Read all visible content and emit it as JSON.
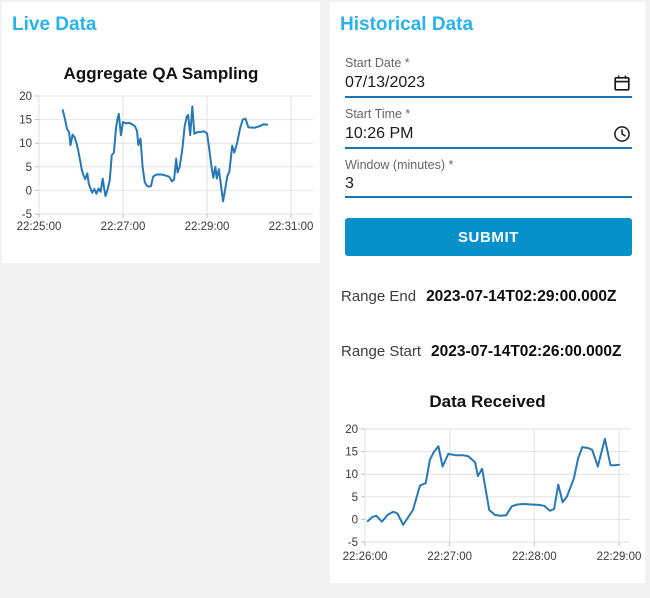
{
  "page": {
    "background_color": "#f2f2f2",
    "accent_color": "#29b2ec"
  },
  "live": {
    "title": "Live Data"
  },
  "historical": {
    "title": "Historical Data",
    "fields": {
      "start_date": {
        "label": "Start Date *",
        "value": "07/13/2023",
        "icon": "calendar-icon"
      },
      "start_time": {
        "label": "Start Time *",
        "value": "10:26 PM",
        "icon": "clock-icon"
      },
      "window": {
        "label": "Window (minutes) *",
        "value": "3"
      }
    },
    "submit_label": "SUBMIT",
    "submit_color": "#0791ca",
    "underline_color": "#1b74b8",
    "range_end": {
      "label": "Range End",
      "value": "2023-07-14T02:29:00.000Z"
    },
    "range_start": {
      "label": "Range Start",
      "value": "2023-07-14T02:26:00.000Z"
    }
  },
  "chart_data": [
    {
      "id": "live-chart",
      "type": "line",
      "title": "Aggregate QA Sampling",
      "xlabel": "",
      "ylabel": "",
      "line_color": "#2878b5",
      "grid": true,
      "x_axis": {
        "origin_time": "22:25:00",
        "unit": "seconds after 22:25:00",
        "ticks": [
          {
            "s": 0,
            "label": "22:25:00"
          },
          {
            "s": 120,
            "label": "22:27:00"
          },
          {
            "s": 240,
            "label": "22:29:00"
          },
          {
            "s": 360,
            "label": "22:31:00"
          }
        ]
      },
      "y_axis": {
        "min": -5,
        "max": 20,
        "ticks": [
          -5,
          0,
          5,
          10,
          15,
          20
        ]
      },
      "points": [
        [
          34,
          17.0
        ],
        [
          37,
          15.2
        ],
        [
          40,
          13.0
        ],
        [
          43,
          12.3
        ],
        [
          45,
          9.6
        ],
        [
          48,
          11.8
        ],
        [
          51,
          11.2
        ],
        [
          53,
          10.3
        ],
        [
          56,
          8.5
        ],
        [
          58,
          6.9
        ],
        [
          61,
          4.5
        ],
        [
          63,
          3.4
        ],
        [
          66,
          2.4
        ],
        [
          69,
          3.6
        ],
        [
          71,
          1.5
        ],
        [
          73,
          0.6
        ],
        [
          76,
          -0.5
        ],
        [
          79,
          0.3
        ],
        [
          82,
          -0.7
        ],
        [
          85,
          0.4
        ],
        [
          88,
          -0.3
        ],
        [
          91,
          2.5
        ],
        [
          93,
          0.5
        ],
        [
          95,
          -1.2
        ],
        [
          98,
          0.2
        ],
        [
          101,
          2.1
        ],
        [
          104,
          7.5
        ],
        [
          107,
          8.0
        ],
        [
          110,
          13.2
        ],
        [
          112,
          15.0
        ],
        [
          114,
          16.2
        ],
        [
          117,
          11.7
        ],
        [
          120,
          14.5
        ],
        [
          124,
          14.2
        ],
        [
          129,
          14.3
        ],
        [
          133,
          14.0
        ],
        [
          137,
          13.6
        ],
        [
          140,
          12.6
        ],
        [
          142,
          9.6
        ],
        [
          145,
          11.0
        ],
        [
          148,
          5.0
        ],
        [
          151,
          1.8
        ],
        [
          154,
          1.0
        ],
        [
          157,
          0.8
        ],
        [
          160,
          0.9
        ],
        [
          163,
          2.9
        ],
        [
          167,
          3.3
        ],
        [
          172,
          3.4
        ],
        [
          177,
          3.3
        ],
        [
          182,
          3.1
        ],
        [
          186,
          2.9
        ],
        [
          190,
          1.9
        ],
        [
          193,
          2.3
        ],
        [
          196,
          6.7
        ],
        [
          198,
          3.8
        ],
        [
          201,
          5.0
        ],
        [
          205,
          9.0
        ],
        [
          208,
          13.5
        ],
        [
          211,
          15.6
        ],
        [
          213,
          16.0
        ],
        [
          216,
          11.7
        ],
        [
          219,
          17.8
        ],
        [
          222,
          12.0
        ],
        [
          226,
          12.3
        ],
        [
          231,
          12.4
        ],
        [
          236,
          12.5
        ],
        [
          240,
          12.1
        ],
        [
          243,
          9.0
        ],
        [
          246,
          5.5
        ],
        [
          249,
          2.7
        ],
        [
          252,
          5.0
        ],
        [
          254,
          2.5
        ],
        [
          257,
          4.5
        ],
        [
          260,
          1.0
        ],
        [
          263,
          -2.3
        ],
        [
          266,
          0.3
        ],
        [
          269,
          3.0
        ],
        [
          272,
          4.0
        ],
        [
          276,
          9.5
        ],
        [
          279,
          8.0
        ],
        [
          283,
          10.0
        ],
        [
          287,
          13.0
        ],
        [
          291,
          15.0
        ],
        [
          295,
          15.2
        ],
        [
          299,
          13.4
        ],
        [
          304,
          13.3
        ],
        [
          309,
          13.3
        ],
        [
          315,
          13.6
        ],
        [
          321,
          14.0
        ],
        [
          326,
          13.9
        ]
      ]
    },
    {
      "id": "historical-chart",
      "type": "line",
      "title": "Data Received",
      "xlabel": "",
      "ylabel": "",
      "line_color": "#2878b5",
      "grid": true,
      "x_axis": {
        "origin_time": "22:26:00",
        "unit": "seconds after 22:26:00",
        "ticks": [
          {
            "s": 0,
            "label": "22:26:00"
          },
          {
            "s": 60,
            "label": "22:27:00"
          },
          {
            "s": 120,
            "label": "22:28:00"
          },
          {
            "s": 180,
            "label": "22:29:00"
          }
        ]
      },
      "y_axis": {
        "min": -5,
        "max": 20,
        "ticks": [
          -5,
          0,
          5,
          10,
          15,
          20
        ]
      },
      "points": [
        [
          2,
          -0.4
        ],
        [
          5,
          0.5
        ],
        [
          8,
          0.8
        ],
        [
          12,
          -0.5
        ],
        [
          16,
          1.0
        ],
        [
          20,
          1.7
        ],
        [
          23,
          1.3
        ],
        [
          27,
          -1.2
        ],
        [
          30,
          0.2
        ],
        [
          34,
          2.1
        ],
        [
          39,
          7.5
        ],
        [
          43,
          8.0
        ],
        [
          46,
          13.2
        ],
        [
          49,
          15.0
        ],
        [
          52,
          16.2
        ],
        [
          55,
          11.7
        ],
        [
          59,
          14.5
        ],
        [
          64,
          14.2
        ],
        [
          69,
          14.2
        ],
        [
          73,
          14.0
        ],
        [
          76,
          13.2
        ],
        [
          78,
          12.6
        ],
        [
          80,
          9.6
        ],
        [
          83,
          11.2
        ],
        [
          88,
          2.1
        ],
        [
          92,
          1.0
        ],
        [
          96,
          0.8
        ],
        [
          100,
          0.9
        ],
        [
          104,
          2.9
        ],
        [
          108,
          3.3
        ],
        [
          113,
          3.4
        ],
        [
          118,
          3.3
        ],
        [
          123,
          3.2
        ],
        [
          127,
          3.0
        ],
        [
          131,
          1.9
        ],
        [
          134,
          2.3
        ],
        [
          137,
          7.7
        ],
        [
          140,
          3.8
        ],
        [
          143,
          5.0
        ],
        [
          148,
          9.0
        ],
        [
          151,
          13.5
        ],
        [
          154,
          16.0
        ],
        [
          158,
          15.8
        ],
        [
          161,
          15.4
        ],
        [
          165,
          11.7
        ],
        [
          170,
          17.8
        ],
        [
          174,
          12.0
        ],
        [
          177,
          12.0
        ],
        [
          180,
          12.1
        ]
      ]
    }
  ]
}
